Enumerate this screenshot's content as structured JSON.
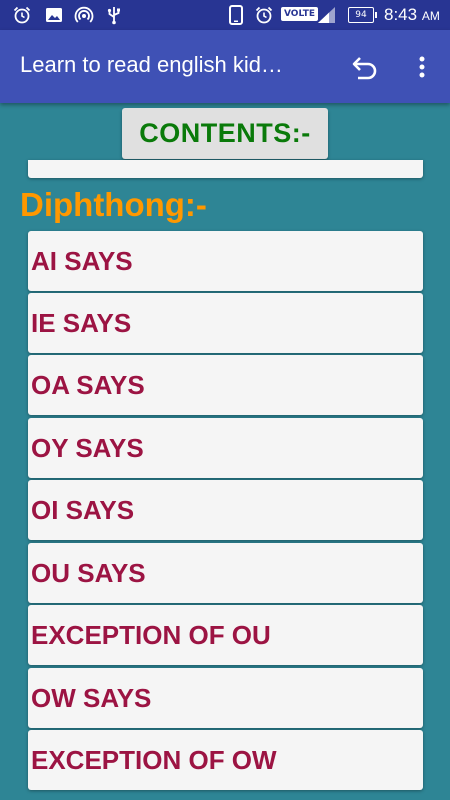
{
  "status_bar": {
    "time": "8:43",
    "ampm": "AM",
    "battery": "94",
    "network_badge": "VOLTE",
    "left_icons": [
      "alarm-icon",
      "image-icon",
      "hotspot-icon",
      "usb-icon"
    ],
    "right_icons": [
      "phone-icon",
      "alarm-icon",
      "volte-badge",
      "signal-icon",
      "battery-icon"
    ]
  },
  "app_bar": {
    "title": "Learn to read english kid…",
    "actions": [
      "undo-icon",
      "overflow-menu-icon"
    ]
  },
  "contents_button": {
    "label": "CONTENTS:-"
  },
  "section": {
    "heading": "Diphthong:-"
  },
  "items": [
    {
      "label": "AI SAYS"
    },
    {
      "label": "IE SAYS"
    },
    {
      "label": "OA SAYS"
    },
    {
      "label": "OY SAYS"
    },
    {
      "label": "OI SAYS"
    },
    {
      "label": "OU SAYS"
    },
    {
      "label": "EXCEPTION OF OU"
    },
    {
      "label": "OW SAYS"
    },
    {
      "label": "EXCEPTION OF OW"
    }
  ],
  "colors": {
    "status_bar": "#283593",
    "app_bar": "#3f51b5",
    "background": "#2e8595",
    "contents_text": "#0a7a0a",
    "heading": "#ff9800",
    "item_text": "#9c1443",
    "card": "#f5f5f5"
  }
}
